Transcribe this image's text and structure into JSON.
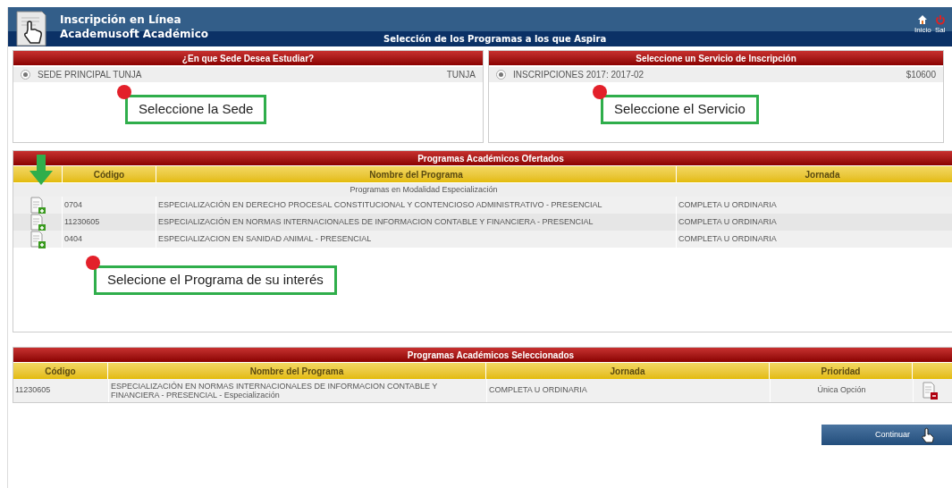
{
  "header": {
    "title": "Inscripción en Línea",
    "subtitle": "Academusoft Académico",
    "page_title": "Selección de los Programas a los que Aspira",
    "nav": [
      {
        "kind": "home",
        "label": "Inicio"
      },
      {
        "kind": "power",
        "label": "Sal"
      }
    ]
  },
  "sede_panel": {
    "title": "¿En que Sede Desea Estudiar?",
    "options": [
      {
        "label": "SEDE PRINCIPAL TUNJA",
        "detail": "TUNJA",
        "selected": true
      }
    ],
    "callout": "Seleccione la Sede"
  },
  "service_panel": {
    "title": "Seleccione un Servicio de Inscripción",
    "options": [
      {
        "label": "INSCRIPCIONES 2017: 2017-02",
        "detail": "$10600",
        "selected": true
      }
    ],
    "callout": "Seleccione el Servicio"
  },
  "offered": {
    "title": "Programas Académicos Ofertados",
    "columns": [
      "Código",
      "Nombre del Programa",
      "Jornada"
    ],
    "group": "Programas en Modalidad Especialización",
    "rows": [
      {
        "code": "0704",
        "name": "ESPECIALIZACIÓN EN DERECHO PROCESAL CONSTITUCIONAL Y CONTENCIOSO ADMINISTRATIVO - PRESENCIAL",
        "schedule": "COMPLETA U ORDINARIA"
      },
      {
        "code": "11230605",
        "name": "ESPECIALIZACIÓN EN NORMAS INTERNACIONALES DE INFORMACION CONTABLE Y FINANCIERA - PRESENCIAL",
        "schedule": "COMPLETA U ORDINARIA"
      },
      {
        "code": "0404",
        "name": "ESPECIALIZACION EN SANIDAD ANIMAL - PRESENCIAL",
        "schedule": "COMPLETA U ORDINARIA"
      }
    ],
    "callout": "Selecione el Programa de su interés"
  },
  "selected": {
    "title": "Programas Académicos Seleccionados",
    "columns": [
      "Código",
      "Nombre del Programa",
      "Jornada",
      "Prioridad"
    ],
    "rows": [
      {
        "code": "11230605",
        "name": "ESPECIALIZACIÓN EN NORMAS INTERNACIONALES DE INFORMACION CONTABLE Y FINANCIERA - PRESENCIAL - Especialización",
        "schedule": "COMPLETA U ORDINARIA",
        "priority": "Única Opción"
      }
    ]
  },
  "continue_button": "Continuar"
}
